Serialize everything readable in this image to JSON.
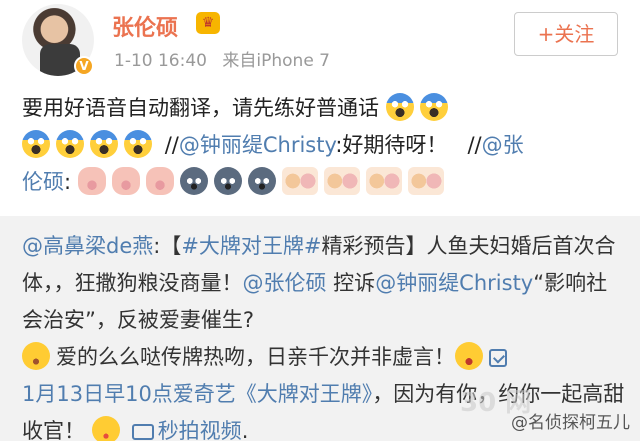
{
  "header": {
    "username": "张伦硕",
    "verified_badge": "V",
    "crown_icon": "crown-icon",
    "time": "1-10 16:40",
    "source": "来自iPhone 7",
    "follow_label": "+关注"
  },
  "post": {
    "line1": "要用好语音自动翻译，请先练好普通话",
    "slash1": "//",
    "mention1": "@钟丽缇Christy",
    "text1": ":好期待呀！",
    "slash2": "//",
    "mention2a": "@张",
    "mention2b": "伦硕",
    "text2": ":"
  },
  "repost": {
    "author": "@高鼻梁de燕",
    "colon": ":",
    "tag_open": "【",
    "hashtag": "#大牌对王牌#",
    "tag_rest": "精彩预告】人鱼夫妇婚后首次合体，，狂撒狗粮没商量！",
    "mention_a": "@张伦硕",
    "text_a": " 控诉",
    "mention_b": "@钟丽缇Christy",
    "text_b": "“影响社会治安”，反被爱妻催生?",
    "text_c": "爱的么么哒传牌热吻，日亲千次并非虚言！",
    "event": "1月13日早10点爱奇艺《大牌对王牌》",
    "text_d": "，因为有你，约你一起高甜收官！",
    "video_label": "秒拍视频",
    "text_e": "."
  },
  "watermark": {
    "faint": "30 网",
    "handle": "@名侦探柯五儿"
  }
}
